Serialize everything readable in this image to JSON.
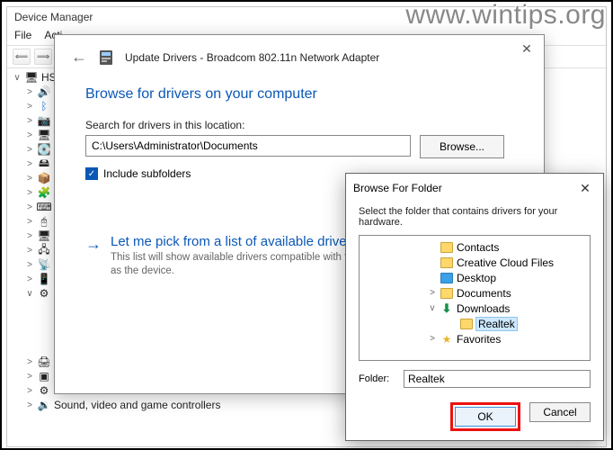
{
  "watermark": "www.wintips.org",
  "device_manager": {
    "title": "Device Manager",
    "menu": [
      "File",
      "Acti"
    ],
    "tree": {
      "root": "HSE",
      "bottom_nodes": [
        "Print queues",
        "Processors",
        "Software devices",
        "Sound, video and game controllers"
      ]
    }
  },
  "update_dialog": {
    "title": "Update Drivers - Broadcom 802.11n Network Adapter",
    "heading": "Browse for drivers on your computer",
    "search_label": "Search for drivers in this location:",
    "path_value": "C:\\Users\\Administrator\\Documents",
    "browse_label": "Browse...",
    "include_label": "Include subfolders",
    "pick_title": "Let me pick from a list of available drivers o",
    "pick_sub": "This list will show available drivers compatible with the de\nsame category as the device."
  },
  "browse_folder": {
    "title": "Browse For Folder",
    "subtitle": "Select the folder that contains drivers for your hardware.",
    "items": [
      {
        "name": "Contacts",
        "icon": "folder",
        "indent": 74
      },
      {
        "name": "Creative Cloud Files",
        "icon": "folder",
        "indent": 74
      },
      {
        "name": "Desktop",
        "icon": "desktop",
        "indent": 74
      },
      {
        "name": "Documents",
        "icon": "folder",
        "indent": 74,
        "twisty": ">"
      },
      {
        "name": "Downloads",
        "icon": "download",
        "indent": 74,
        "twisty": "v"
      },
      {
        "name": "Realtek",
        "icon": "folder",
        "indent": 96,
        "selected": true
      },
      {
        "name": "Favorites",
        "icon": "star",
        "indent": 74,
        "twisty": ">"
      }
    ],
    "folder_label": "Folder:",
    "folder_value": "Realtek",
    "ok": "OK",
    "cancel": "Cancel"
  }
}
